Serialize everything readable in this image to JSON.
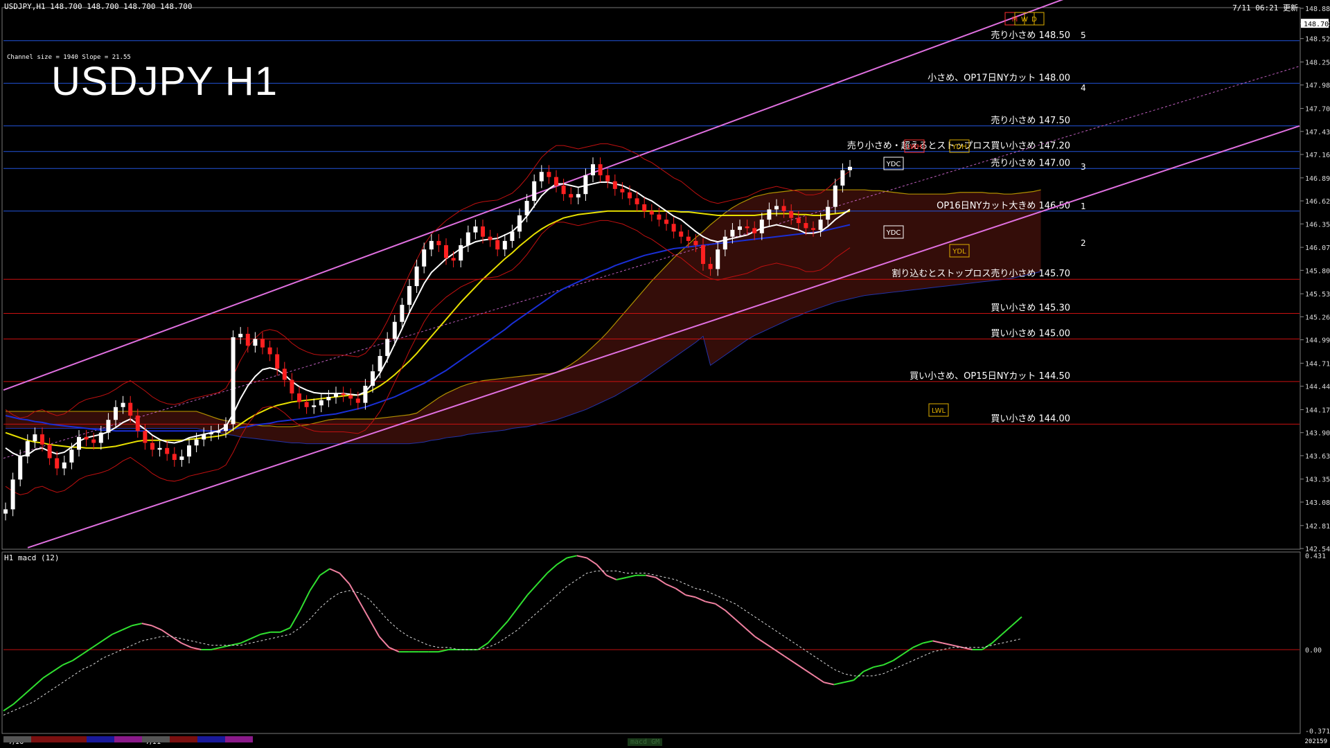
{
  "header": {
    "symbol_line": "USDJPY,H1  148.700 148.700 148.700 148.700",
    "datetime": "7/11 06:21 更新",
    "channel_info": "Channel size = 1940 Slope = 21.55",
    "big_title": "USDJPY H1",
    "macd_label": "H1  macd (12)",
    "bottom_tab": "macd GM",
    "bottom_right_code": "202159"
  },
  "chart_data": [
    {
      "type": "line",
      "title": "USDJPY H1",
      "ylim": [
        142.54,
        148.88
      ],
      "price_ticks": [
        "148.880",
        "148.700",
        "148.525",
        "148.250",
        "147.980",
        "147.705",
        "147.435",
        "147.165",
        "146.890",
        "146.620",
        "146.350",
        "146.075",
        "145.805",
        "145.530",
        "145.260",
        "144.990",
        "144.715",
        "144.445",
        "144.170",
        "143.900",
        "143.630",
        "143.355",
        "143.085",
        "142.810",
        "142.540"
      ],
      "current_price": "148.700",
      "x_labels": [
        "7/10",
        "7/11"
      ],
      "levels": [
        {
          "price": 148.5,
          "label": "売り小さめ 148.50",
          "color": "#2255dd"
        },
        {
          "price": 148.0,
          "label": "小さめ、OP17日NYカット 148.00",
          "color": "#2255dd"
        },
        {
          "price": 147.5,
          "label": "売り小さめ 147.50",
          "color": "#2255dd"
        },
        {
          "price": 147.2,
          "label": "売り小さめ・超えるとストップロス買い小さめ 147.20",
          "color": "#2255dd"
        },
        {
          "price": 147.0,
          "label": "売り小さめ 147.00",
          "color": "#2255dd"
        },
        {
          "price": 146.5,
          "label": "OP16日NYカット大きめ 146.50",
          "color": "#2255dd"
        },
        {
          "price": 145.7,
          "label": "割り込むとストップロス売り小さめ 145.70",
          "color": "#cc1111"
        },
        {
          "price": 145.3,
          "label": "買い小さめ 145.30",
          "color": "#cc1111"
        },
        {
          "price": 145.0,
          "label": "買い小さめ 145.00",
          "color": "#cc1111"
        },
        {
          "price": 144.5,
          "label": "買い小さめ、OP15日NYカット 144.50",
          "color": "#cc1111"
        },
        {
          "price": 144.0,
          "label": "買い小さめ 144.00",
          "color": "#cc1111"
        }
      ],
      "markers": [
        "YDC",
        "YDC",
        "LWH",
        "YDH",
        "YDL",
        "LWL",
        "M",
        "W",
        "D"
      ],
      "projection_labels": [
        "5",
        "4",
        "3",
        "1",
        "2"
      ],
      "close_series": [
        143.0,
        143.35,
        143.62,
        143.8,
        143.88,
        143.76,
        143.6,
        143.48,
        143.55,
        143.7,
        143.85,
        143.82,
        143.78,
        143.9,
        144.05,
        144.2,
        144.25,
        144.1,
        143.92,
        143.78,
        143.7,
        143.72,
        143.65,
        143.58,
        143.62,
        143.75,
        143.82,
        143.88,
        143.9,
        143.92,
        144.0,
        145.02,
        145.06,
        144.92,
        145.0,
        144.9,
        144.82,
        144.65,
        144.52,
        144.36,
        144.26,
        144.2,
        144.22,
        144.28,
        144.32,
        144.36,
        144.34,
        144.3,
        144.25,
        144.45,
        144.62,
        144.8,
        145.0,
        145.2,
        145.4,
        145.62,
        145.85,
        146.05,
        146.15,
        146.1,
        145.95,
        145.92,
        146.1,
        146.25,
        146.32,
        146.2,
        146.16,
        146.05,
        146.15,
        146.26,
        146.45,
        146.62,
        146.85,
        146.96,
        146.9,
        146.8,
        146.7,
        146.66,
        146.7,
        146.92,
        147.05,
        146.92,
        146.85,
        146.76,
        146.72,
        146.65,
        146.58,
        146.5,
        146.46,
        146.4,
        146.35,
        146.26,
        146.2,
        146.15,
        146.1,
        145.88,
        145.82,
        146.05,
        146.2,
        146.28,
        146.32,
        146.3,
        146.24,
        146.4,
        146.52,
        146.56,
        146.5,
        146.42,
        146.36,
        146.3,
        146.28,
        146.4,
        146.55,
        146.8,
        146.98,
        147.02
      ],
      "ma_white": [
        143.72,
        143.66,
        143.62,
        143.64,
        143.7,
        143.72,
        143.68,
        143.65,
        143.67,
        143.73,
        143.8,
        143.84,
        143.86,
        143.88,
        143.91,
        143.96,
        144.02,
        144.06,
        144.0,
        143.94,
        143.87,
        143.82,
        143.79,
        143.78,
        143.8,
        143.84,
        143.86,
        143.88,
        143.9,
        143.92,
        143.97,
        144.12,
        144.3,
        144.45,
        144.56,
        144.64,
        144.66,
        144.64,
        144.58,
        144.5,
        144.44,
        144.4,
        144.37,
        144.36,
        144.36,
        144.36,
        144.36,
        144.35,
        144.34,
        144.38,
        144.48,
        144.6,
        144.76,
        144.94,
        145.12,
        145.31,
        145.48,
        145.65,
        145.78,
        145.86,
        145.94,
        146.0,
        146.06,
        146.1,
        146.14,
        146.16,
        146.17,
        146.18,
        146.22,
        146.26,
        146.34,
        146.44,
        146.56,
        146.68,
        146.76,
        146.82,
        146.82,
        146.8,
        146.78,
        146.8,
        146.82,
        146.84,
        146.84,
        146.82,
        146.8,
        146.76,
        146.72,
        146.66,
        146.62,
        146.56,
        146.5,
        146.44,
        146.4,
        146.33,
        146.26,
        146.2,
        146.16,
        146.14,
        146.16,
        146.18,
        146.2,
        146.22,
        146.26,
        146.3,
        146.32,
        146.34,
        146.32,
        146.3,
        146.28,
        146.24,
        146.24,
        146.26,
        146.32,
        146.4,
        146.46,
        146.52
      ],
      "ma_yellow": [
        143.9,
        143.87,
        143.84,
        143.81,
        143.79,
        143.78,
        143.76,
        143.75,
        143.74,
        143.73,
        143.73,
        143.72,
        143.72,
        143.72,
        143.73,
        143.74,
        143.76,
        143.78,
        143.8,
        143.81,
        143.81,
        143.81,
        143.81,
        143.81,
        143.81,
        143.82,
        143.83,
        143.84,
        143.85,
        143.86,
        143.88,
        143.94,
        144.0,
        144.06,
        144.11,
        144.15,
        144.19,
        144.22,
        144.24,
        144.26,
        144.27,
        144.28,
        144.29,
        144.3,
        144.31,
        144.32,
        144.33,
        144.34,
        144.34,
        144.36,
        144.4,
        144.45,
        144.51,
        144.58,
        144.66,
        144.74,
        144.83,
        144.93,
        145.03,
        145.13,
        145.23,
        145.33,
        145.43,
        145.52,
        145.61,
        145.7,
        145.78,
        145.86,
        145.94,
        146.01,
        146.09,
        146.16,
        146.23,
        146.29,
        146.34,
        146.38,
        146.42,
        146.44,
        146.46,
        146.47,
        146.48,
        146.49,
        146.5,
        146.5,
        146.5,
        146.5,
        146.5,
        146.5,
        146.5,
        146.5,
        146.5,
        146.5,
        146.49,
        146.49,
        146.48,
        146.47,
        146.46,
        146.45,
        146.45,
        146.45,
        146.45,
        146.45,
        146.45,
        146.46,
        146.47,
        146.47,
        146.47,
        146.47,
        146.46,
        146.46,
        146.45,
        146.45,
        146.46,
        146.47,
        146.48,
        146.5
      ],
      "ma_blue": [
        144.1,
        144.08,
        144.06,
        144.05,
        144.03,
        144.02,
        144.0,
        143.99,
        143.98,
        143.97,
        143.96,
        143.95,
        143.94,
        143.93,
        143.93,
        143.92,
        143.92,
        143.92,
        143.92,
        143.92,
        143.92,
        143.92,
        143.92,
        143.92,
        143.92,
        143.92,
        143.92,
        143.92,
        143.92,
        143.92,
        143.93,
        143.94,
        143.96,
        143.97,
        143.99,
        144.0,
        144.01,
        144.03,
        144.04,
        144.05,
        144.06,
        144.07,
        144.08,
        144.1,
        144.11,
        144.12,
        144.14,
        144.16,
        144.18,
        144.2,
        144.23,
        144.26,
        144.29,
        144.32,
        144.36,
        144.4,
        144.44,
        144.48,
        144.53,
        144.58,
        144.63,
        144.69,
        144.75,
        144.81,
        144.87,
        144.93,
        144.99,
        145.05,
        145.11,
        145.18,
        145.24,
        145.3,
        145.36,
        145.42,
        145.48,
        145.54,
        145.59,
        145.63,
        145.67,
        145.71,
        145.75,
        145.79,
        145.82,
        145.86,
        145.89,
        145.92,
        145.95,
        145.98,
        146.0,
        146.02,
        146.04,
        146.06,
        146.07,
        146.08,
        146.09,
        146.1,
        146.11,
        146.12,
        146.13,
        146.14,
        146.15,
        146.16,
        146.17,
        146.18,
        146.19,
        146.2,
        146.21,
        146.22,
        146.23,
        146.24,
        146.25,
        146.26,
        146.28,
        146.3,
        146.32,
        146.34
      ]
    },
    {
      "type": "line",
      "title": "H1  macd (12)",
      "ylim": [
        -0.371,
        0.431
      ],
      "y_ticks": [
        "0.431",
        "0.00",
        "-0.371"
      ],
      "macd": [
        -0.28,
        -0.25,
        -0.21,
        -0.17,
        -0.13,
        -0.1,
        -0.07,
        -0.05,
        -0.02,
        0.01,
        0.04,
        0.07,
        0.09,
        0.11,
        0.12,
        0.11,
        0.09,
        0.06,
        0.03,
        0.01,
        0.0,
        0.0,
        0.01,
        0.02,
        0.03,
        0.05,
        0.07,
        0.08,
        0.08,
        0.1,
        0.18,
        0.27,
        0.34,
        0.37,
        0.35,
        0.3,
        0.22,
        0.14,
        0.06,
        0.01,
        -0.01,
        -0.01,
        -0.01,
        -0.01,
        -0.01,
        0.0,
        0.0,
        0.0,
        0.0,
        0.03,
        0.08,
        0.13,
        0.19,
        0.25,
        0.3,
        0.35,
        0.39,
        0.42,
        0.43,
        0.42,
        0.39,
        0.34,
        0.32,
        0.33,
        0.34,
        0.34,
        0.33,
        0.3,
        0.28,
        0.25,
        0.24,
        0.22,
        0.21,
        0.18,
        0.14,
        0.1,
        0.06,
        0.03,
        0.0,
        -0.03,
        -0.06,
        -0.09,
        -0.12,
        -0.15,
        -0.16,
        -0.15,
        -0.14,
        -0.1,
        -0.08,
        -0.07,
        -0.05,
        -0.02,
        0.01,
        0.03,
        0.04,
        0.03,
        0.02,
        0.01,
        0.0,
        0.0,
        0.03,
        0.07,
        0.11,
        0.15
      ],
      "signal": [
        -0.3,
        -0.28,
        -0.26,
        -0.24,
        -0.21,
        -0.18,
        -0.15,
        -0.12,
        -0.09,
        -0.07,
        -0.04,
        -0.02,
        0.0,
        0.02,
        0.04,
        0.05,
        0.06,
        0.06,
        0.05,
        0.04,
        0.03,
        0.02,
        0.02,
        0.02,
        0.02,
        0.03,
        0.04,
        0.05,
        0.06,
        0.07,
        0.1,
        0.14,
        0.19,
        0.23,
        0.26,
        0.27,
        0.26,
        0.23,
        0.18,
        0.13,
        0.09,
        0.06,
        0.04,
        0.02,
        0.01,
        0.01,
        0.0,
        0.0,
        0.0,
        0.01,
        0.03,
        0.06,
        0.09,
        0.13,
        0.17,
        0.21,
        0.25,
        0.29,
        0.32,
        0.35,
        0.36,
        0.36,
        0.36,
        0.35,
        0.35,
        0.35,
        0.34,
        0.33,
        0.32,
        0.3,
        0.28,
        0.27,
        0.25,
        0.23,
        0.21,
        0.18,
        0.15,
        0.12,
        0.09,
        0.06,
        0.03,
        0.0,
        -0.03,
        -0.06,
        -0.09,
        -0.11,
        -0.12,
        -0.12,
        -0.12,
        -0.11,
        -0.09,
        -0.07,
        -0.05,
        -0.03,
        -0.01,
        0.0,
        0.01,
        0.01,
        0.01,
        0.01,
        0.02,
        0.03,
        0.04,
        0.05
      ]
    }
  ]
}
